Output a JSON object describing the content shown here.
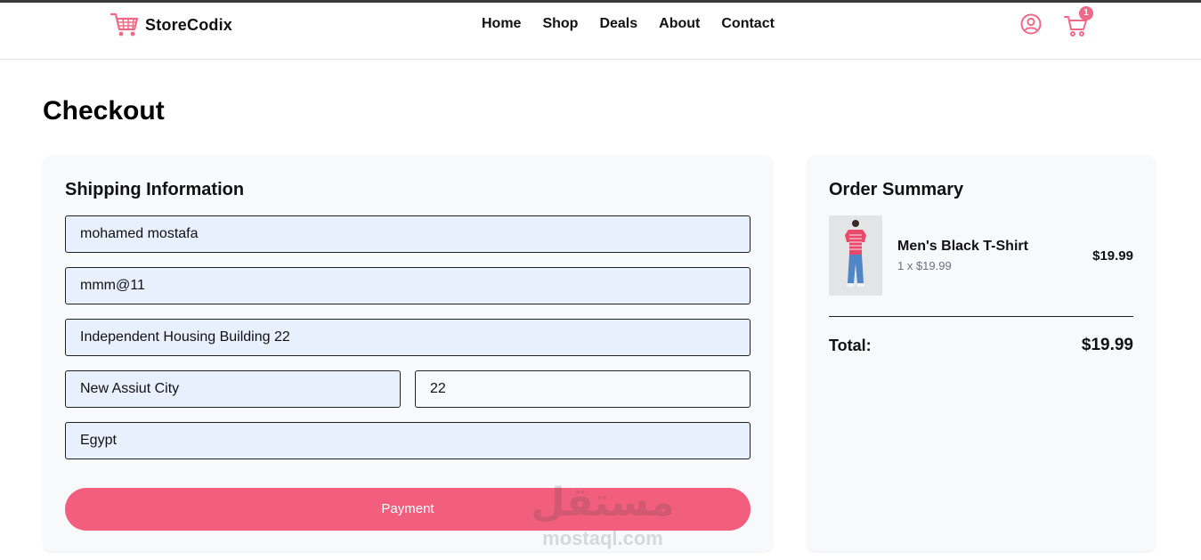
{
  "brand": {
    "name": "StoreCodix",
    "accent": "#f06a87"
  },
  "nav": {
    "items": [
      "Home",
      "Shop",
      "Deals",
      "About",
      "Contact"
    ]
  },
  "header": {
    "cart_count": "1"
  },
  "page": {
    "title": "Checkout"
  },
  "shipping": {
    "title": "Shipping Information",
    "fields": {
      "name": "mohamed mostafa",
      "email": "mmm@11",
      "address": "Independent Housing Building 22",
      "city": "New Assiut City",
      "postal": "22",
      "country": "Egypt"
    },
    "button": "Payment"
  },
  "summary": {
    "title": "Order Summary",
    "items": [
      {
        "name": "Men's Black T-Shirt",
        "qty_line": "1 x $19.99",
        "price": "$19.99"
      }
    ],
    "total_label": "Total:",
    "total_value": "$19.99"
  },
  "watermark": {
    "arabic": "مستقل",
    "latin": "mostaql.com"
  }
}
